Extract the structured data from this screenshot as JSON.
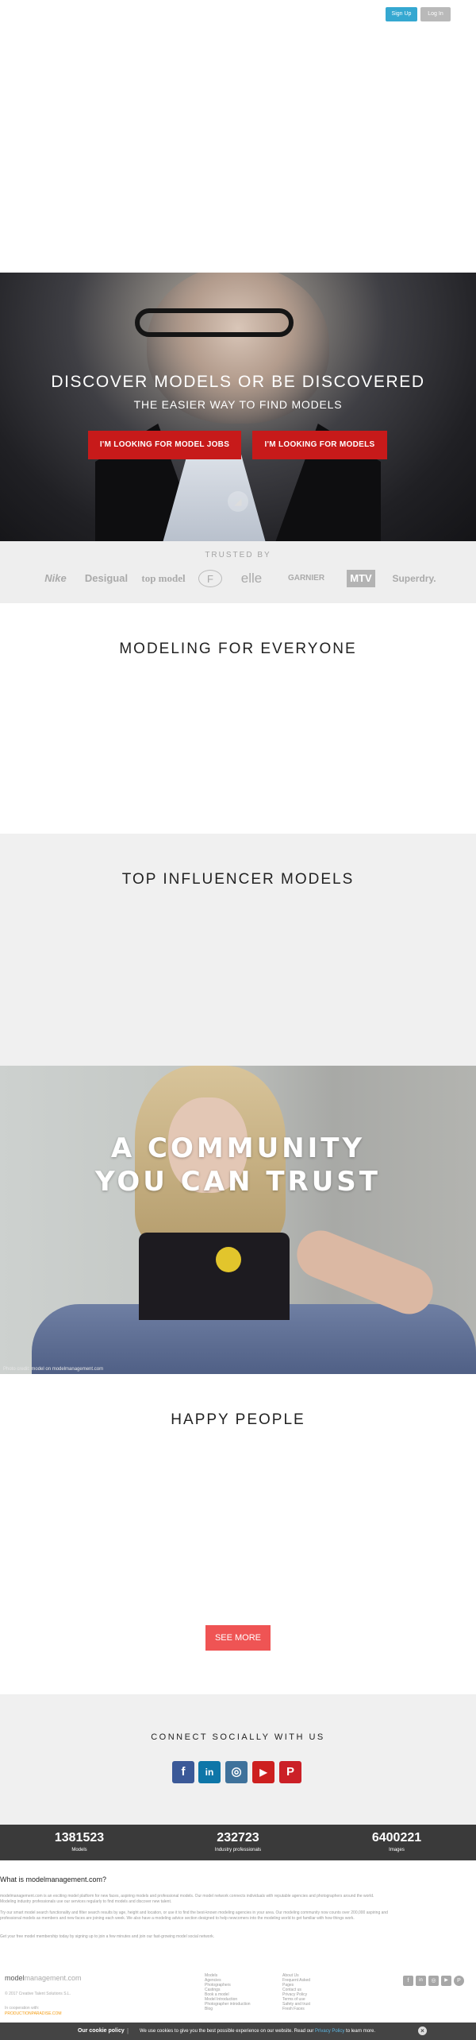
{
  "header": {
    "signup_label": "Sign Up",
    "login_label": "Log In"
  },
  "hero": {
    "title": "DISCOVER MODELS OR BE DISCOVERED",
    "subtitle": "THE EASIER WAY TO FIND MODELS",
    "btn_jobs": "I'M LOOKING FOR MODEL JOBS",
    "btn_models": "I'M LOOKING FOR MODELS",
    "mute_icon": "speaker-icon"
  },
  "trusted": {
    "title": "TRUSTED BY",
    "logos": [
      "Nike",
      "Desigual",
      "top model",
      "F",
      "elle",
      "GARNIER",
      "MTV",
      "Superdry."
    ]
  },
  "modeling": {
    "title": "MODELING FOR EVERYONE"
  },
  "influencer": {
    "title": "TOP INFLUENCER MODELS"
  },
  "community": {
    "line1": "A COMMUNITY",
    "line2": "YOU CAN TRUST",
    "credit": "Photo credit: model on modelmanagement.com"
  },
  "happy": {
    "title": "HAPPY PEOPLE",
    "see_more": "SEE MORE"
  },
  "social": {
    "title": "CONNECT SOCIALLY WITH US",
    "icons": [
      "f",
      "in",
      "◎",
      "▶",
      "P"
    ],
    "colors": [
      "#3b5998",
      "#0e76a8",
      "#3f729b",
      "#cd201f",
      "#cb2027"
    ]
  },
  "stats": [
    {
      "value": "1381523",
      "label": "Models"
    },
    {
      "value": "232723",
      "label": "Industry professionals"
    },
    {
      "value": "6400221",
      "label": "Images"
    }
  ],
  "about": {
    "heading": "What is modelmanagement.com?",
    "p1": "modelmanagement.com is an exciting model platform for new faces, aspiring models and professional models. Our model network connects individuals with reputable agencies and photographers around the world. Modeling industry professionals use our services regularly to find models and discover new talent.",
    "p2": "Try our smart model search functionality and filter search results by age, height and location, or use it to find the best-known modeling agencies in your area. Our modeling community now counts over 200,000 aspiring and professional models as members and new faces are joining each week. We also have a modeling advice section designed to help newcomers into the modeling world to get familiar with how things work.",
    "p3": "Get your free model membership today by signing up to join a few minutes and join our fast-growing model social network."
  },
  "footer": {
    "logo_a": "model",
    "logo_b": "management.com",
    "copyright": "© 2017 Creative Talent Solutions S.L.",
    "cooperation": "In cooperation with:",
    "partner": "PRODUCTIONPARADISE.COM",
    "links_col1": [
      "Models",
      "Agencies",
      "Photographers",
      "Castings",
      "Book a model",
      "Model Introduction",
      "Photographer introduction",
      "Blog"
    ],
    "links_col2": [
      "About Us",
      "Frequent Asked",
      "Pages",
      "Contact us",
      "Privacy Policy",
      "Terms of use",
      "Safety and trust",
      "Fresh Faces"
    ],
    "icons": [
      "f",
      "in",
      "◎",
      "▶",
      "P"
    ]
  },
  "cookie": {
    "title": "Our cookie policy",
    "separator": "|",
    "text": "We use cookies to give you the best possible experience on our website. Read our",
    "link": "Privacy Policy",
    "text_end": "to learn more.",
    "close": "×"
  }
}
